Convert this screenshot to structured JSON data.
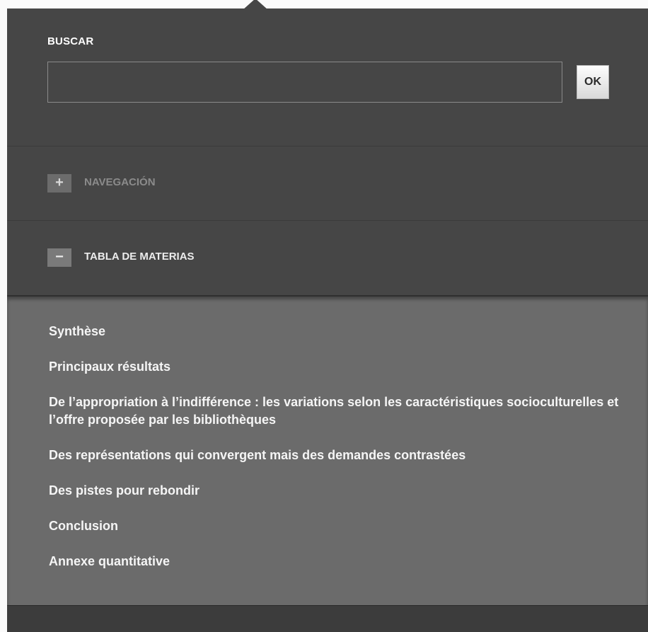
{
  "search": {
    "title": "BUSCAR",
    "value": "",
    "button_label": "OK"
  },
  "navegacion": {
    "toggle": "+",
    "label": "NAVEGACIÓN"
  },
  "tabla": {
    "toggle": "−",
    "label": "TABLA DE MATERIAS",
    "items": [
      "Synthèse",
      "Principaux résultats",
      "De l’appropriation à l’indifférence : les variations selon les caractéristiques socioculturelles et l’offre proposée par les bibliothèques",
      "Des représentations qui convergent mais des demandes contrastées",
      "Des pistes pour rebondir",
      "Conclusion",
      "Annexe quantitative"
    ]
  },
  "colors": {
    "panel": "#464646",
    "toc_background": "#6b6b6b",
    "text": "#ffffff"
  }
}
